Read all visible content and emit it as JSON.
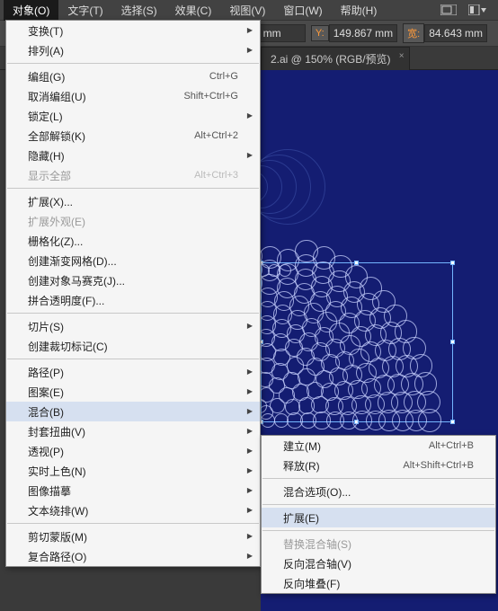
{
  "menubar": {
    "items": [
      "对象(O)",
      "文字(T)",
      "选择(S)",
      "效果(C)",
      "视图(V)",
      "窗口(W)",
      "帮助(H)"
    ]
  },
  "toolbar": {
    "xunit": "mm",
    "ylabel": "Y:",
    "yval": "149.867",
    "yunit": "mm",
    "wlabel": "宽:",
    "wval": "84.643",
    "wunit": "mm",
    "extra": "2"
  },
  "tab": {
    "title": "2.ai @ 150% (RGB/预览)"
  },
  "menu1_groups": [
    [
      {
        "label": "变换(T)",
        "sub": true
      },
      {
        "label": "排列(A)",
        "sub": true
      }
    ],
    [
      {
        "label": "编组(G)",
        "shortcut": "Ctrl+G"
      },
      {
        "label": "取消编组(U)",
        "shortcut": "Shift+Ctrl+G"
      },
      {
        "label": "锁定(L)",
        "sub": true
      },
      {
        "label": "全部解锁(K)",
        "shortcut": "Alt+Ctrl+2"
      },
      {
        "label": "隐藏(H)",
        "sub": true
      },
      {
        "label": "显示全部",
        "shortcut": "Alt+Ctrl+3",
        "disabled": true
      }
    ],
    [
      {
        "label": "扩展(X)..."
      },
      {
        "label": "扩展外观(E)",
        "disabled": true
      },
      {
        "label": "栅格化(Z)..."
      },
      {
        "label": "创建渐变网格(D)..."
      },
      {
        "label": "创建对象马赛克(J)..."
      },
      {
        "label": "拼合透明度(F)..."
      }
    ],
    [
      {
        "label": "切片(S)",
        "sub": true
      },
      {
        "label": "创建裁切标记(C)"
      }
    ],
    [
      {
        "label": "路径(P)",
        "sub": true
      },
      {
        "label": "图案(E)",
        "sub": true
      },
      {
        "label": "混合(B)",
        "sub": true,
        "highlight": true
      },
      {
        "label": "封套扭曲(V)",
        "sub": true
      },
      {
        "label": "透视(P)",
        "sub": true
      },
      {
        "label": "实时上色(N)",
        "sub": true
      },
      {
        "label": "图像描摹",
        "sub": true
      },
      {
        "label": "文本绕排(W)",
        "sub": true
      }
    ],
    [
      {
        "label": "剪切蒙版(M)",
        "sub": true
      },
      {
        "label": "复合路径(O)",
        "sub": true
      }
    ]
  ],
  "menu2_groups": [
    [
      {
        "label": "建立(M)",
        "shortcut": "Alt+Ctrl+B"
      },
      {
        "label": "释放(R)",
        "shortcut": "Alt+Shift+Ctrl+B"
      }
    ],
    [
      {
        "label": "混合选项(O)..."
      }
    ],
    [
      {
        "label": "扩展(E)",
        "highlight": true
      }
    ],
    [
      {
        "label": "替换混合轴(S)",
        "disabled": true
      },
      {
        "label": "反向混合轴(V)"
      },
      {
        "label": "反向堆叠(F)"
      }
    ]
  ]
}
